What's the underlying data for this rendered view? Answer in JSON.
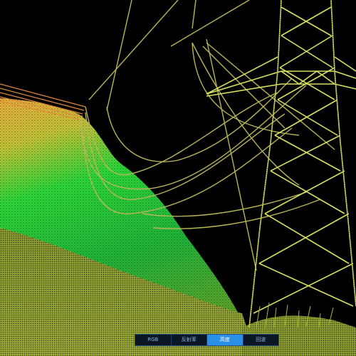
{
  "viewer": {
    "render_mode": "elevation",
    "mode_tabs": [
      {
        "label": "RGB",
        "active": false
      },
      {
        "label": "反射率",
        "active": false
      },
      {
        "label": "高度",
        "active": true
      },
      {
        "label": "回波",
        "active": false
      }
    ],
    "colors": {
      "background": "#000000",
      "tower": "#d8e060",
      "conductor": "#b8b458",
      "vegetation_low": "#6fa02c",
      "vegetation_mid": "#1fd23a",
      "vegetation_high": "#f0b040",
      "tab_active": "#2a8fe6",
      "tab_bg": "#0b1624"
    }
  }
}
